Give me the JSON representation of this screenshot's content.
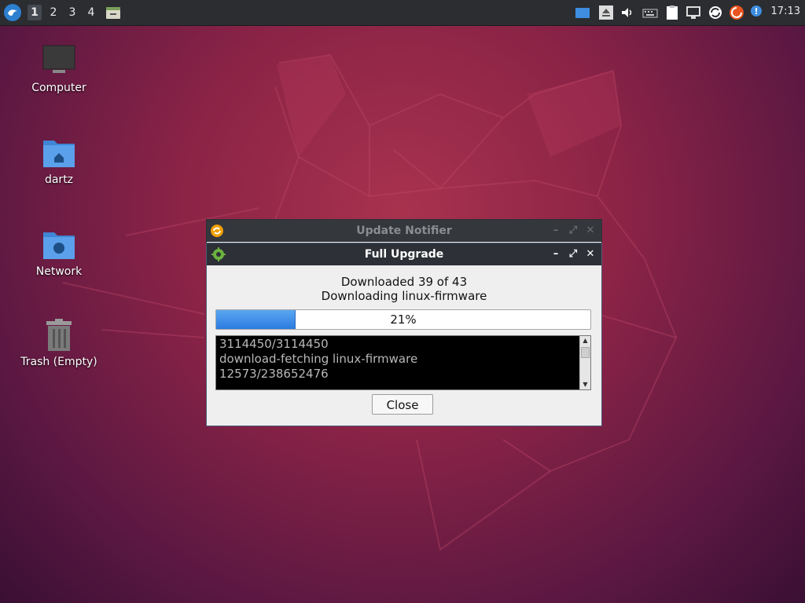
{
  "panel": {
    "workspaces": [
      "1",
      "2",
      "3",
      "4"
    ],
    "active_workspace": "1",
    "clock": "17:13",
    "tray_icons": [
      "blue-window-icon",
      "eject-icon",
      "volume-icon",
      "keyboard-icon",
      "clipboard-icon",
      "network-icon",
      "sync-icon",
      "ubuntu-update-icon",
      "notification-icon"
    ]
  },
  "desktop": {
    "icons": [
      {
        "label": "Computer",
        "icon": "monitor-icon"
      },
      {
        "label": "dartz",
        "icon": "home-folder-icon"
      },
      {
        "label": "Network",
        "icon": "network-folder-icon"
      },
      {
        "label": "Trash (Empty)",
        "icon": "trash-icon"
      }
    ]
  },
  "notifier_window": {
    "title": "Update Notifier"
  },
  "upgrade_window": {
    "title": "Full Upgrade",
    "status_line1": "Downloaded 39 of 43",
    "status_line2": "Downloading linux-firmware",
    "progress": 21,
    "progress_label": "21%",
    "log_lines": [
      "3114450/3114450",
      "download-fetching linux-firmware",
      "12573/238652476"
    ],
    "close_label": "Close"
  },
  "colors": {
    "panel_bg": "#2b2d31",
    "progress_fill": "#3a8de8",
    "window_border": "#4a5d7a"
  }
}
